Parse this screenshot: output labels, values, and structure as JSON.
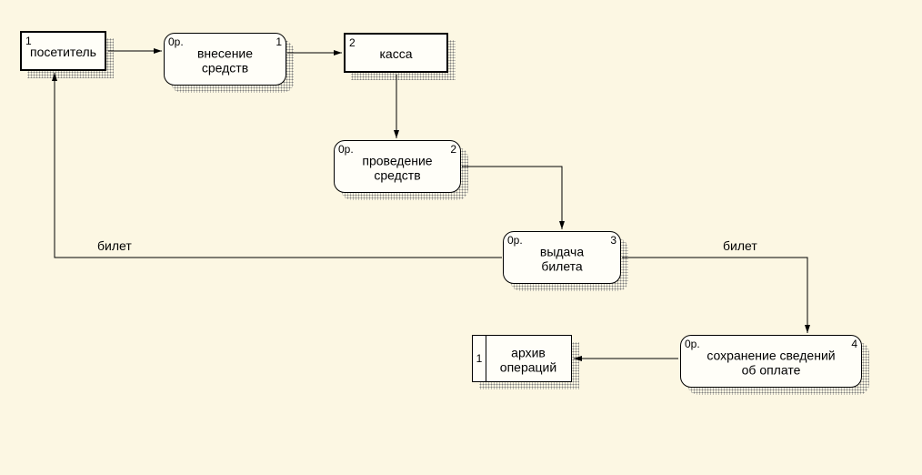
{
  "nodes": {
    "visitor": {
      "tl": "1",
      "tr": "",
      "label": "посетитель"
    },
    "deposit": {
      "tl": "0р.",
      "tr": "1",
      "label": "внесение\nсредств"
    },
    "kassa": {
      "tl": "2",
      "tr": "",
      "label": "касса"
    },
    "conduct": {
      "tl": "0р.",
      "tr": "2",
      "label": "проведение\nсредств"
    },
    "issue": {
      "tl": "0р.",
      "tr": "3",
      "label": "выдача\nбилета"
    },
    "save": {
      "tl": "0р.",
      "tr": "4",
      "label": "сохранение сведений\nоб оплате"
    },
    "archive": {
      "bar": "1",
      "label": "архив\nопераций"
    }
  },
  "edgeLabels": {
    "ticket_left": "билет",
    "ticket_right": "билет"
  }
}
